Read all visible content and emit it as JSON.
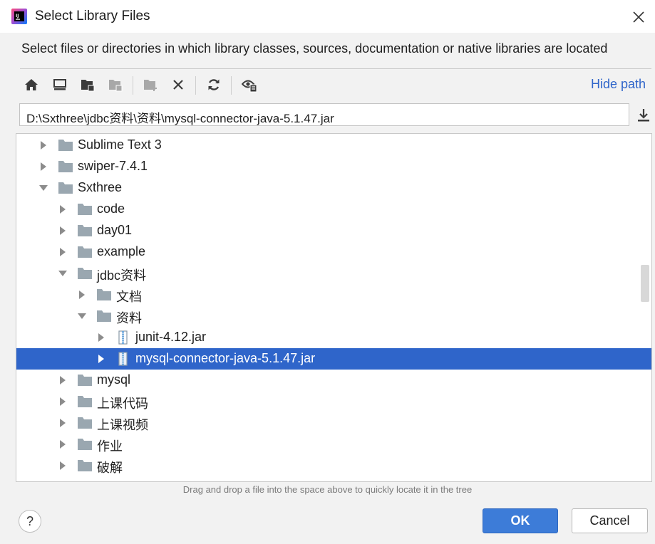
{
  "window": {
    "title": "Select Library Files",
    "description": "Select files or directories in which library classes, sources, documentation or native libraries are located"
  },
  "toolbar": {
    "buttons": [
      "home-icon",
      "desktop-icon",
      "project-folder-icon",
      "module-folder-icon",
      "new-folder-icon",
      "delete-icon",
      "refresh-icon",
      "show-hidden-icon"
    ],
    "hide_path_label": "Hide path"
  },
  "path_field": {
    "value": "D:\\Sxthree\\jdbc资料\\资料\\mysql-connector-java-5.1.47.jar"
  },
  "tree": {
    "items": [
      {
        "label": "Sublime Text 3",
        "depth": 0,
        "expanded": false,
        "type": "folder"
      },
      {
        "label": "swiper-7.4.1",
        "depth": 0,
        "expanded": false,
        "type": "folder"
      },
      {
        "label": "Sxthree",
        "depth": 0,
        "expanded": true,
        "type": "folder"
      },
      {
        "label": "code",
        "depth": 1,
        "expanded": false,
        "type": "folder"
      },
      {
        "label": "day01",
        "depth": 1,
        "expanded": false,
        "type": "folder"
      },
      {
        "label": "example",
        "depth": 1,
        "expanded": false,
        "type": "folder"
      },
      {
        "label": "jdbc资料",
        "depth": 1,
        "expanded": true,
        "type": "folder"
      },
      {
        "label": "文档",
        "depth": 2,
        "expanded": false,
        "type": "folder"
      },
      {
        "label": "资料",
        "depth": 2,
        "expanded": true,
        "type": "folder"
      },
      {
        "label": "junit-4.12.jar",
        "depth": 3,
        "expanded": false,
        "type": "jar"
      },
      {
        "label": "mysql-connector-java-5.1.47.jar",
        "depth": 3,
        "expanded": false,
        "type": "jar",
        "selected": true
      },
      {
        "label": "mysql",
        "depth": 1,
        "expanded": false,
        "type": "folder"
      },
      {
        "label": "上课代码",
        "depth": 1,
        "expanded": false,
        "type": "folder"
      },
      {
        "label": "上课视频",
        "depth": 1,
        "expanded": false,
        "type": "folder"
      },
      {
        "label": "作业",
        "depth": 1,
        "expanded": false,
        "type": "folder"
      },
      {
        "label": "破解",
        "depth": 1,
        "expanded": false,
        "type": "folder"
      }
    ]
  },
  "hint": "Drag and drop a file into the space above to quickly locate it in the tree",
  "buttons": {
    "ok": "OK",
    "cancel": "Cancel",
    "help": "?"
  },
  "colors": {
    "selection": "#2f65ca",
    "link": "#2f65ca",
    "primary_button": "#3d7cd8",
    "folder": "#9aa7b0"
  }
}
